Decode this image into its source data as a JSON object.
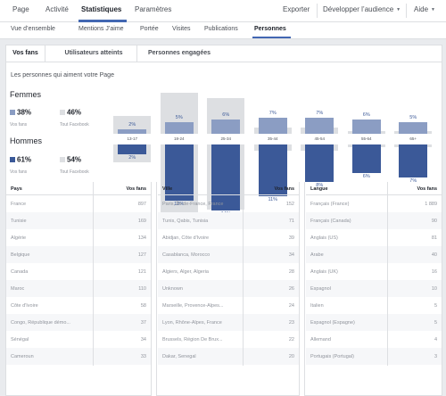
{
  "topnav": {
    "items": [
      {
        "label": "Page",
        "active": false
      },
      {
        "label": "Activité",
        "active": false
      },
      {
        "label": "Statistiques",
        "active": true
      },
      {
        "label": "Paramètres",
        "active": false
      }
    ],
    "right": [
      {
        "label": "Exporter",
        "has_caret": false
      },
      {
        "label": "Développer l’audience",
        "has_caret": true
      },
      {
        "label": "Aide",
        "has_caret": true
      }
    ]
  },
  "subnav": {
    "items": [
      {
        "label": "Vue d’ensemble",
        "active": false
      },
      {
        "label": "Mentions J’aime",
        "active": false
      },
      {
        "label": "Portée",
        "active": false
      },
      {
        "label": "Visites",
        "active": false
      },
      {
        "label": "Publications",
        "active": false
      },
      {
        "label": "Personnes",
        "active": true
      }
    ]
  },
  "tabs": [
    {
      "label": "Vos fans",
      "active": true
    },
    {
      "label": "Utilisateurs atteints",
      "active": false
    },
    {
      "label": "Personnes engagées",
      "active": false
    }
  ],
  "section_title": "Les personnes qui aiment votre Page",
  "legend": {
    "women": {
      "label": "Femmes",
      "fans_pct": "38%",
      "fans_caption": "Vos fans",
      "fb_pct": "46%",
      "fb_caption": "Tout Facebook"
    },
    "men": {
      "label": "Hommes",
      "fans_pct": "61%",
      "fans_caption": "Vos fans",
      "fb_pct": "54%",
      "fb_caption": "Tout Facebook"
    }
  },
  "colors": {
    "women_fans": "#8b9dc3",
    "men_fans": "#3b5998",
    "facebook_overall": "#dddfe2",
    "accent": "#4267b2"
  },
  "chart_data": {
    "type": "bar",
    "categories": [
      "13-17",
      "18-24",
      "25-34",
      "35-44",
      "45-54",
      "55-64",
      "65+"
    ],
    "series": [
      {
        "name": "Femmes",
        "values": [
          2,
          5,
          6,
          7,
          7,
          6,
          5
        ],
        "labels": [
          "2%",
          "5%",
          "6%",
          "7%",
          "7%",
          "6%",
          "5%"
        ]
      },
      {
        "name": "Hommes",
        "values": [
          2,
          12,
          14,
          11,
          8,
          6,
          7
        ],
        "labels": [
          "2%",
          "12%",
          "14%",
          "11%",
          "8%",
          "6%",
          "7%"
        ]
      }
    ],
    "facebook_women": [
      3,
      7,
      6,
      1,
      1,
      0.5,
      0.5
    ],
    "facebook_men": [
      3,
      13,
      11,
      1,
      1,
      0.5,
      0.5
    ],
    "ylim": [
      0,
      14
    ]
  },
  "tables": [
    {
      "col1": "Pays",
      "col2": "Vos fans",
      "rows": [
        [
          "France",
          "897"
        ],
        [
          "Tunisie",
          "169"
        ],
        [
          "Algérie",
          "134"
        ],
        [
          "Belgique",
          "127"
        ],
        [
          "Canada",
          "121"
        ],
        [
          "Maroc",
          "110"
        ],
        [
          "Côte d'Ivoire",
          "58"
        ],
        [
          "Congo, République démo...",
          "37"
        ],
        [
          "Sénégal",
          "34"
        ],
        [
          "Cameroun",
          "33"
        ]
      ]
    },
    {
      "col1": "Ville",
      "col2": "Vos fans",
      "rows": [
        [
          "Paris, Île-de-France, France",
          "152"
        ],
        [
          "Tunis, Qabis, Tunisia",
          "71"
        ],
        [
          "Abidjan, Côte d'Ivoire",
          "39"
        ],
        [
          "Casablanca, Morocco",
          "34"
        ],
        [
          "Algiers, Alger, Algeria",
          "28"
        ],
        [
          "Unknown",
          "26"
        ],
        [
          "Marseille, Provence-Alpes...",
          "24"
        ],
        [
          "Lyon, Rhône-Alpes, France",
          "23"
        ],
        [
          "Brussels, Région De Brux...",
          "22"
        ],
        [
          "Dakar, Senegal",
          "20"
        ]
      ]
    },
    {
      "col1": "Langue",
      "col2": "Vos fans",
      "rows": [
        [
          "Français (France)",
          "1 889"
        ],
        [
          "Français (Canada)",
          "90"
        ],
        [
          "Anglais (US)",
          "81"
        ],
        [
          "Arabe",
          "40"
        ],
        [
          "Anglais (UK)",
          "16"
        ],
        [
          "Espagnol",
          "10"
        ],
        [
          "Italien",
          "5"
        ],
        [
          "Espagnol (Espagne)",
          "5"
        ],
        [
          "Allemand",
          "4"
        ],
        [
          "Portugais (Portugal)",
          "3"
        ]
      ]
    }
  ]
}
